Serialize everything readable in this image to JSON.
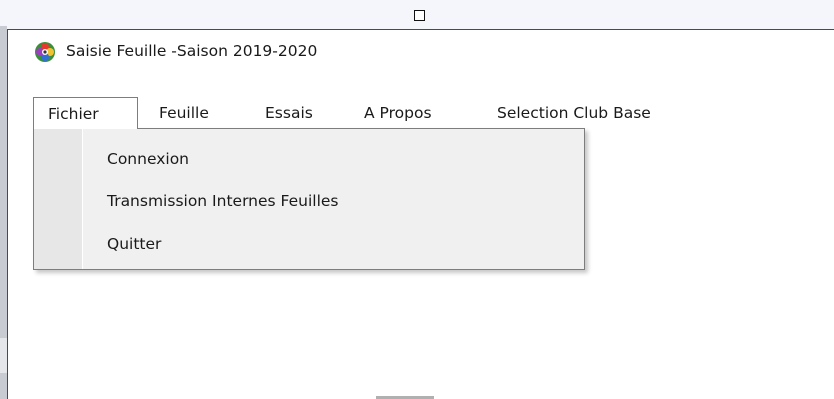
{
  "window": {
    "title": "Saisie Feuille -Saison 2019-2020",
    "icon": "app-flower-icon"
  },
  "menubar": {
    "items": [
      {
        "label": "Fichier",
        "active": true
      },
      {
        "label": "Feuille",
        "active": false
      },
      {
        "label": "Essais",
        "active": false
      },
      {
        "label": "A Propos",
        "active": false
      },
      {
        "label": "Selection Club Base",
        "active": false
      }
    ]
  },
  "dropdown": {
    "items": [
      {
        "label": "Connexion"
      },
      {
        "label": "Transmission Internes Feuilles"
      },
      {
        "label": "Quitter"
      }
    ]
  },
  "colors": {
    "menu_background": "#f0f0f0",
    "window_background": "#ffffff",
    "border": "#7d7d7d"
  }
}
